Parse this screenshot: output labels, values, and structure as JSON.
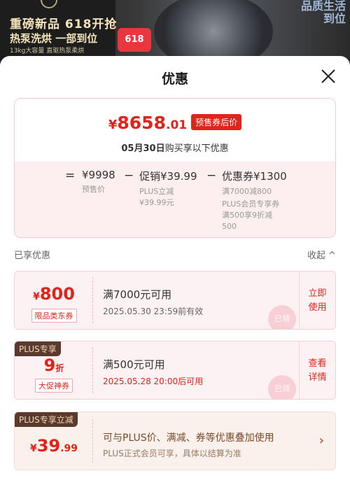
{
  "banner": {
    "line1": "重磅新品 618开抢",
    "line2": "热泵洗烘 一部到位",
    "line3": "13kg大容量 直驱热泵柔烘",
    "badge": "618",
    "right_text": "品质生活\n到位"
  },
  "sheet": {
    "title": "优惠"
  },
  "summary": {
    "final_symbol": "¥",
    "final_int": "8658",
    "final_dec": ".01",
    "final_tag": "预售券后价",
    "note_prefix": "05月30日",
    "note_suffix": "购买享以下优惠",
    "eq": "=",
    "presale_amount": "¥9998",
    "presale_label": "预售价",
    "minus1": "−",
    "promo_amount": "促销¥39.99",
    "promo_sub1": "PLUS立减",
    "promo_sub2": "¥39.99元",
    "minus2": "−",
    "coupon_amount": "优惠券¥1300",
    "coupon_sub1": "满7000减800",
    "coupon_sub2": "PLUS会员专享券",
    "coupon_sub3": "满500享9折减",
    "coupon_sub4": "500"
  },
  "section": {
    "label": "已享优惠",
    "collapse": "收起 ^"
  },
  "coupons": [
    {
      "amount_symbol": "¥",
      "amount": "800",
      "tag": "限品类东券",
      "condition": "满7000元可用",
      "validity": "2025.05.30  23:59前有效",
      "action_line1": "立即",
      "action_line2": "使用",
      "stamp": "已领"
    },
    {
      "badge": "PLUS专享",
      "amount": "9",
      "amount_unit": "折",
      "tag": "大促神券",
      "condition": "满500元可用",
      "validity": "2025.05.28  20:00后可用",
      "action_line1": "查看",
      "action_line2": "详情",
      "stamp": "已领"
    }
  ],
  "plus_card": {
    "badge": "PLUS专享立减",
    "symbol": "¥",
    "int": "39",
    "dec": ".99",
    "line1": "可与PLUS价、满减、券等优惠叠加使用",
    "line2": "PLUS正式会员可享，具体以结算为准",
    "chevron": "›"
  }
}
